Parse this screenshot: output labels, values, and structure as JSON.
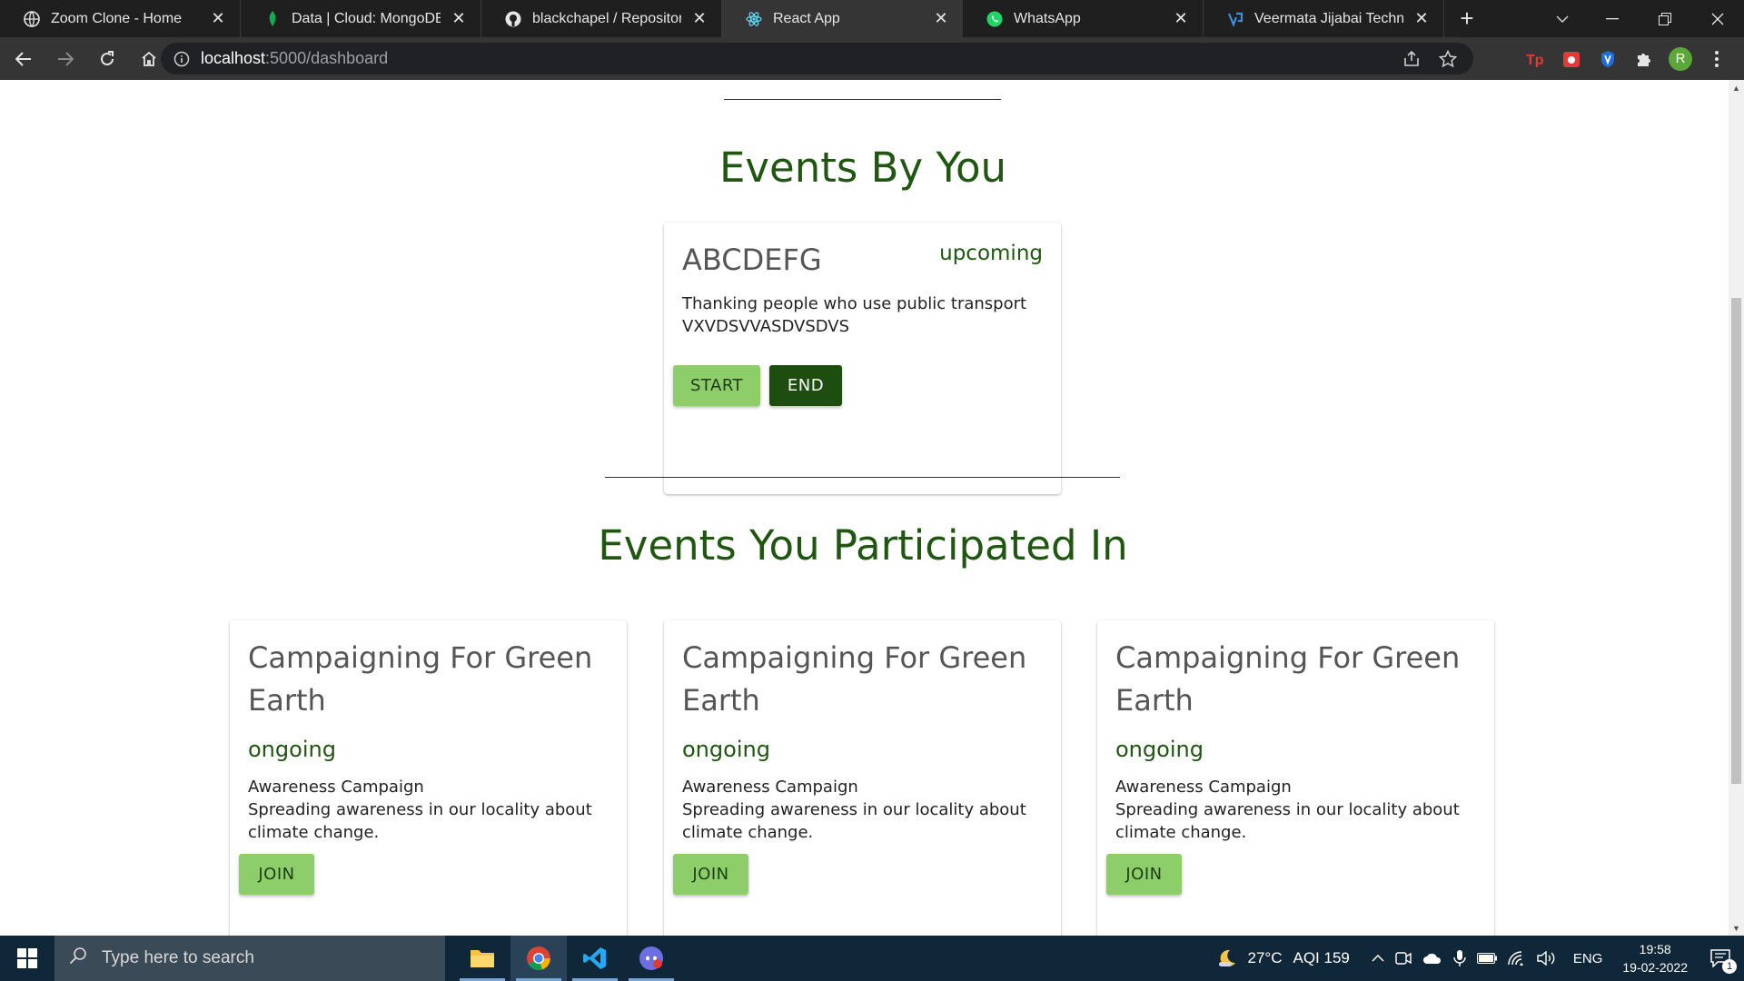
{
  "browser": {
    "tabs": [
      {
        "title": "Zoom Clone - Home",
        "icon": "globe-icon",
        "active": false
      },
      {
        "title": "Data | Cloud: MongoDB Clo",
        "icon": "mongodb-leaf-icon",
        "active": false
      },
      {
        "title": "blackchapel / Repositories",
        "icon": "github-icon",
        "active": false
      },
      {
        "title": "React App",
        "icon": "react-icon",
        "active": true
      },
      {
        "title": "WhatsApp",
        "icon": "whatsapp-icon",
        "active": false
      },
      {
        "title": "Veermata Jijabai Technolog",
        "icon": "vjti-icon",
        "active": false
      }
    ],
    "url_host": "localhost",
    "url_path": ":5000/dashboard",
    "profile_initial": "R"
  },
  "page": {
    "events_by_you": {
      "heading": "Events By You",
      "cards": [
        {
          "title": "ABCDEFG",
          "status": "upcoming",
          "description_line1": "Thanking people who use public transport",
          "description_line2": "VXVDSVVASDVSDVS",
          "start_label": "START",
          "end_label": "END"
        }
      ]
    },
    "events_participated": {
      "heading": "Events You Participated In",
      "cards": [
        {
          "title_line1": "Campaigning For Green",
          "title_line2": "Earth",
          "status": "ongoing",
          "description_line1": "Awareness Campaign",
          "description_line2": "Spreading awareness in our locality about",
          "description_line3": "climate change.",
          "join_label": "JOIN"
        },
        {
          "title_line1": "Campaigning For Green",
          "title_line2": "Earth",
          "status": "ongoing",
          "description_line1": "Awareness Campaign",
          "description_line2": "Spreading awareness in our locality about",
          "description_line3": "climate change.",
          "join_label": "JOIN"
        },
        {
          "title_line1": "Campaigning For Green",
          "title_line2": "Earth",
          "status": "ongoing",
          "description_line1": "Awareness Campaign",
          "description_line2": "Spreading awareness in our locality about",
          "description_line3": "climate change.",
          "join_label": "JOIN"
        }
      ]
    }
  },
  "taskbar": {
    "search_placeholder": "Type here to search",
    "weather": "27°C",
    "aqi": "AQI 159",
    "language": "ENG",
    "time": "19:58",
    "date": "19-02-2022",
    "notification_count": "1"
  },
  "colors": {
    "accent_green": "#1f5710",
    "button_light_green": "#8dce6a",
    "button_dark_green": "#1e4d10"
  }
}
